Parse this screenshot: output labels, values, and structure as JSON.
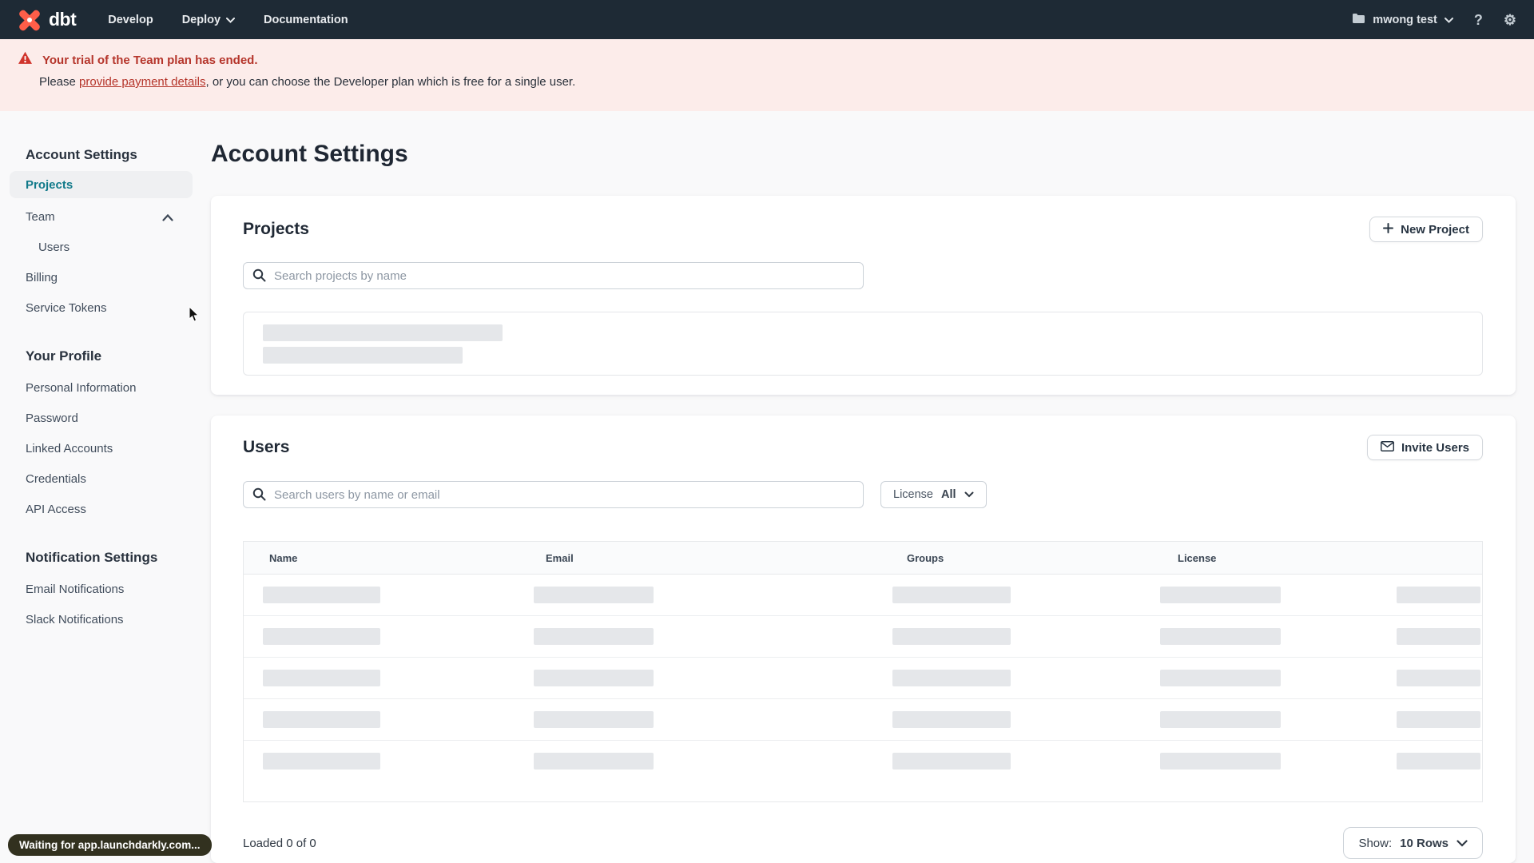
{
  "colors": {
    "nav_bg": "#1e2a35",
    "brand_orange": "#ff5e49",
    "banner_bg": "#fcecea",
    "banner_red": "#b5352b",
    "active_teal": "#117a8a",
    "skeleton_gray": "#e5e7ea"
  },
  "nav": {
    "logo_text": "dbt",
    "items": [
      {
        "label": "Develop"
      },
      {
        "label": "Deploy"
      },
      {
        "label": "Documentation"
      }
    ],
    "account_name": "mwong test",
    "help_glyph": "?",
    "gear_glyph": "⚙"
  },
  "banner": {
    "title": "Your trial of the Team plan has ended.",
    "message_prefix": "Please ",
    "link_text": "provide payment details",
    "message_suffix": ", or you can choose the Developer plan which is free for a single user."
  },
  "sidebar": {
    "sections": [
      {
        "heading": "Account Settings",
        "items": [
          {
            "label": "Projects"
          },
          {
            "label": "Team"
          },
          {
            "label": "Users"
          },
          {
            "label": "Billing"
          },
          {
            "label": "Service Tokens"
          }
        ]
      },
      {
        "heading": "Your Profile",
        "items": [
          {
            "label": "Personal Information"
          },
          {
            "label": "Password"
          },
          {
            "label": "Linked Accounts"
          },
          {
            "label": "Credentials"
          },
          {
            "label": "API Access"
          }
        ]
      },
      {
        "heading": "Notification Settings",
        "items": [
          {
            "label": "Email Notifications"
          },
          {
            "label": "Slack Notifications"
          }
        ]
      }
    ]
  },
  "main": {
    "page_title": "Account Settings",
    "projects_section": {
      "title": "Projects",
      "new_project_button": "New Project",
      "search_placeholder": "Search projects by name"
    },
    "users_section": {
      "title": "Users",
      "invite_users_button": "Invite Users",
      "search_placeholder": "Search users by name or email",
      "license_filter_label": "License",
      "license_filter_value": "All",
      "table_headers": [
        "Name",
        "Email",
        "Groups",
        "License"
      ],
      "footer": {
        "loaded_text": "Loaded 0 of 0",
        "show_label": "Show:",
        "show_value": "10 Rows"
      }
    }
  },
  "status_bar": {
    "text": "Waiting for app.launchdarkly.com..."
  }
}
